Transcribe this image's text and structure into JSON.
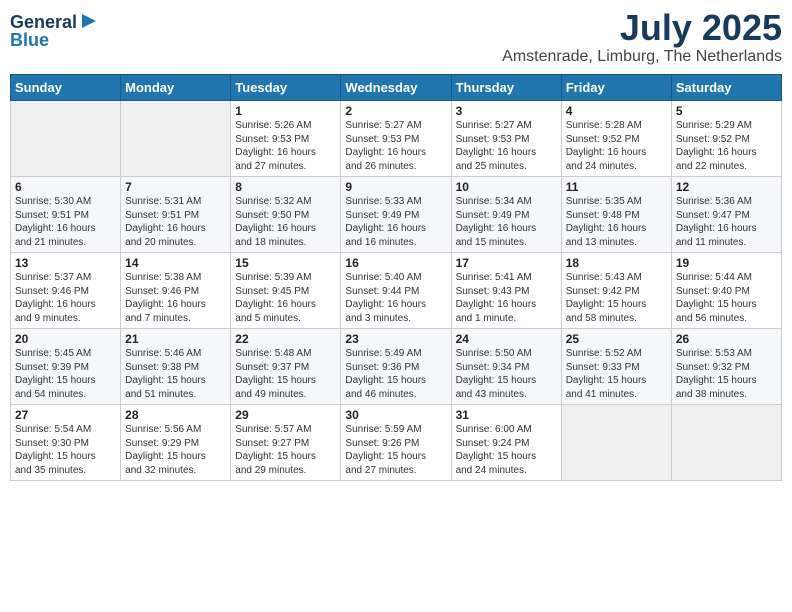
{
  "header": {
    "logo_line1": "General",
    "logo_line2": "Blue",
    "month": "July 2025",
    "location": "Amstenrade, Limburg, The Netherlands"
  },
  "days_of_week": [
    "Sunday",
    "Monday",
    "Tuesday",
    "Wednesday",
    "Thursday",
    "Friday",
    "Saturday"
  ],
  "weeks": [
    [
      {
        "day": "",
        "info": ""
      },
      {
        "day": "",
        "info": ""
      },
      {
        "day": "1",
        "info": "Sunrise: 5:26 AM\nSunset: 9:53 PM\nDaylight: 16 hours\nand 27 minutes."
      },
      {
        "day": "2",
        "info": "Sunrise: 5:27 AM\nSunset: 9:53 PM\nDaylight: 16 hours\nand 26 minutes."
      },
      {
        "day": "3",
        "info": "Sunrise: 5:27 AM\nSunset: 9:53 PM\nDaylight: 16 hours\nand 25 minutes."
      },
      {
        "day": "4",
        "info": "Sunrise: 5:28 AM\nSunset: 9:52 PM\nDaylight: 16 hours\nand 24 minutes."
      },
      {
        "day": "5",
        "info": "Sunrise: 5:29 AM\nSunset: 9:52 PM\nDaylight: 16 hours\nand 22 minutes."
      }
    ],
    [
      {
        "day": "6",
        "info": "Sunrise: 5:30 AM\nSunset: 9:51 PM\nDaylight: 16 hours\nand 21 minutes."
      },
      {
        "day": "7",
        "info": "Sunrise: 5:31 AM\nSunset: 9:51 PM\nDaylight: 16 hours\nand 20 minutes."
      },
      {
        "day": "8",
        "info": "Sunrise: 5:32 AM\nSunset: 9:50 PM\nDaylight: 16 hours\nand 18 minutes."
      },
      {
        "day": "9",
        "info": "Sunrise: 5:33 AM\nSunset: 9:49 PM\nDaylight: 16 hours\nand 16 minutes."
      },
      {
        "day": "10",
        "info": "Sunrise: 5:34 AM\nSunset: 9:49 PM\nDaylight: 16 hours\nand 15 minutes."
      },
      {
        "day": "11",
        "info": "Sunrise: 5:35 AM\nSunset: 9:48 PM\nDaylight: 16 hours\nand 13 minutes."
      },
      {
        "day": "12",
        "info": "Sunrise: 5:36 AM\nSunset: 9:47 PM\nDaylight: 16 hours\nand 11 minutes."
      }
    ],
    [
      {
        "day": "13",
        "info": "Sunrise: 5:37 AM\nSunset: 9:46 PM\nDaylight: 16 hours\nand 9 minutes."
      },
      {
        "day": "14",
        "info": "Sunrise: 5:38 AM\nSunset: 9:46 PM\nDaylight: 16 hours\nand 7 minutes."
      },
      {
        "day": "15",
        "info": "Sunrise: 5:39 AM\nSunset: 9:45 PM\nDaylight: 16 hours\nand 5 minutes."
      },
      {
        "day": "16",
        "info": "Sunrise: 5:40 AM\nSunset: 9:44 PM\nDaylight: 16 hours\nand 3 minutes."
      },
      {
        "day": "17",
        "info": "Sunrise: 5:41 AM\nSunset: 9:43 PM\nDaylight: 16 hours\nand 1 minute."
      },
      {
        "day": "18",
        "info": "Sunrise: 5:43 AM\nSunset: 9:42 PM\nDaylight: 15 hours\nand 58 minutes."
      },
      {
        "day": "19",
        "info": "Sunrise: 5:44 AM\nSunset: 9:40 PM\nDaylight: 15 hours\nand 56 minutes."
      }
    ],
    [
      {
        "day": "20",
        "info": "Sunrise: 5:45 AM\nSunset: 9:39 PM\nDaylight: 15 hours\nand 54 minutes."
      },
      {
        "day": "21",
        "info": "Sunrise: 5:46 AM\nSunset: 9:38 PM\nDaylight: 15 hours\nand 51 minutes."
      },
      {
        "day": "22",
        "info": "Sunrise: 5:48 AM\nSunset: 9:37 PM\nDaylight: 15 hours\nand 49 minutes."
      },
      {
        "day": "23",
        "info": "Sunrise: 5:49 AM\nSunset: 9:36 PM\nDaylight: 15 hours\nand 46 minutes."
      },
      {
        "day": "24",
        "info": "Sunrise: 5:50 AM\nSunset: 9:34 PM\nDaylight: 15 hours\nand 43 minutes."
      },
      {
        "day": "25",
        "info": "Sunrise: 5:52 AM\nSunset: 9:33 PM\nDaylight: 15 hours\nand 41 minutes."
      },
      {
        "day": "26",
        "info": "Sunrise: 5:53 AM\nSunset: 9:32 PM\nDaylight: 15 hours\nand 38 minutes."
      }
    ],
    [
      {
        "day": "27",
        "info": "Sunrise: 5:54 AM\nSunset: 9:30 PM\nDaylight: 15 hours\nand 35 minutes."
      },
      {
        "day": "28",
        "info": "Sunrise: 5:56 AM\nSunset: 9:29 PM\nDaylight: 15 hours\nand 32 minutes."
      },
      {
        "day": "29",
        "info": "Sunrise: 5:57 AM\nSunset: 9:27 PM\nDaylight: 15 hours\nand 29 minutes."
      },
      {
        "day": "30",
        "info": "Sunrise: 5:59 AM\nSunset: 9:26 PM\nDaylight: 15 hours\nand 27 minutes."
      },
      {
        "day": "31",
        "info": "Sunrise: 6:00 AM\nSunset: 9:24 PM\nDaylight: 15 hours\nand 24 minutes."
      },
      {
        "day": "",
        "info": ""
      },
      {
        "day": "",
        "info": ""
      }
    ]
  ]
}
